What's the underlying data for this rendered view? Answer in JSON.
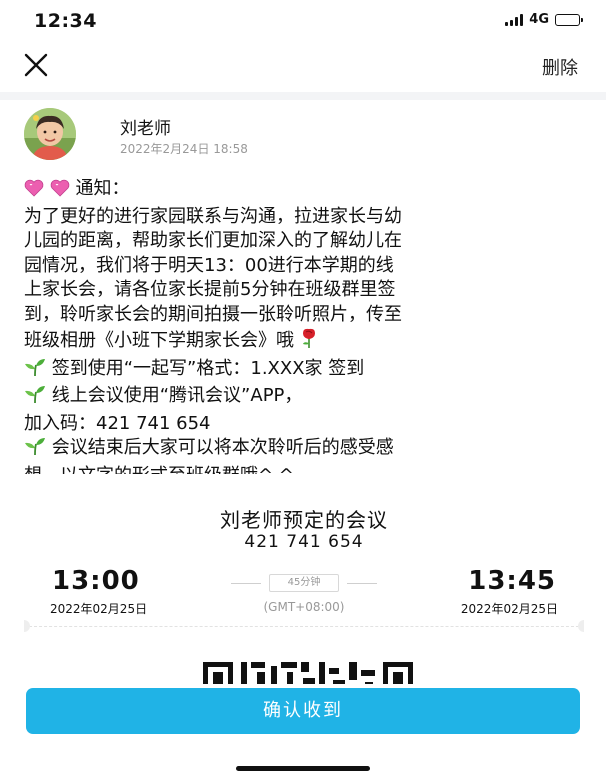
{
  "status_bar": {
    "time": "12:34",
    "network": "4G"
  },
  "nav": {
    "close_icon": "close-icon",
    "delete_label": "删除"
  },
  "author": {
    "name": "刘老师",
    "date": "2022年2月24日 18:58"
  },
  "content": {
    "notice_label": "通知：",
    "lines": [
      "为了更好的进行家园联系与沟通，拉进家长与幼",
      "儿园的距离，帮助家长们更加深入的了解幼儿在",
      "园情况，我们将于明天13：00进行本学期的线",
      "上家长会，请各位家长提前5分钟在班级群里签",
      "到，聆听家长会的期间拍摄一张聆听照片，传至",
      "班级相册《小班下学期家长会》哦"
    ],
    "bullet_1": "签到使用“一起写”格式：1.XXX家 签到",
    "bullet_2": "线上会议使用“腾讯会议”APP，",
    "join_code": "加入码：421 741 654",
    "bullet_3_line1": "会议结束后大家可以将本次聆听后的感受感",
    "bullet_3_line2": "想，以文字的形式至班级群哦^ ^",
    "icons": {
      "heart": "heart-icon",
      "rose": "rose-icon",
      "sprout": "sprout-icon"
    }
  },
  "meeting": {
    "title": "刘老师预定的会议",
    "id": "421 741 654",
    "start_time": "13:00",
    "end_time": "13:45",
    "duration": "45分钟",
    "start_date": "2022年02月25日",
    "end_date": "2022年02月25日",
    "timezone": "(GMT+08:00)"
  },
  "confirm_label": "确认收到",
  "colors": {
    "accent": "#20b3e6",
    "heart": "#ec5fb0",
    "sprout": "#4cae3a",
    "rose": "#d6202a"
  }
}
